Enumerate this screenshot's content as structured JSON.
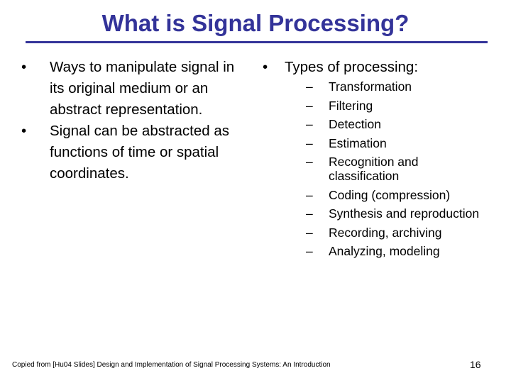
{
  "slide": {
    "title": "What is Signal Processing?",
    "accent_color": "#333399",
    "left_column": {
      "bullets": [
        "Ways to manipulate signal in its original medium or an abstract representation.",
        "Signal can be abstracted as functions of time or spatial coordinates."
      ]
    },
    "right_column": {
      "heading_bullet": "Types of processing:",
      "sub_items": [
        "Transformation",
        "Filtering",
        "Detection",
        "Estimation",
        "Recognition and classification",
        "Coding (compression)",
        "Synthesis and reproduction",
        "Recording, archiving",
        "Analyzing, modeling"
      ]
    },
    "bullet_glyph": "•",
    "dash_glyph": "–",
    "footer": "Copied from  [Hu04 Slides] Design and Implementation of Signal Processing Systems: An Introduction",
    "page_number": "16"
  }
}
